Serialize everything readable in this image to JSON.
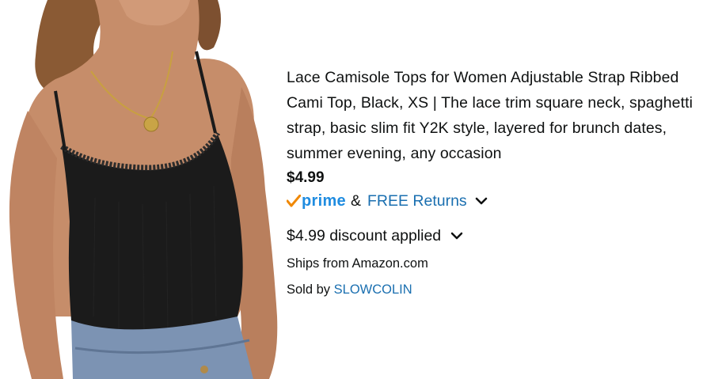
{
  "product": {
    "image_alt": "Woman wearing black lace camisole top with jeans",
    "title": "Lace Camisole Tops for Women Adjustable Strap Ribbed Cami Top, Black, XS | The lace trim square neck, spaghetti strap, basic slim fit Y2K style, layered for brunch dates, summer evening, any occasion",
    "price": "$4.99",
    "prime_label": "prime",
    "amp": "&",
    "free_returns": "FREE Returns",
    "discount_text": "$4.99 discount applied",
    "ships_from": "Ships from Amazon.com",
    "sold_by_prefix": "Sold by",
    "seller": "SLOWCOLIN"
  },
  "colors": {
    "link": "#1a6fb0",
    "prime_blue": "#1f8ce0",
    "prime_check": "#f08804",
    "text": "#0f1111",
    "garment": "#1b1b1b"
  },
  "icons": {
    "prime": "prime-check-icon",
    "expand": "chevron-down-icon"
  }
}
